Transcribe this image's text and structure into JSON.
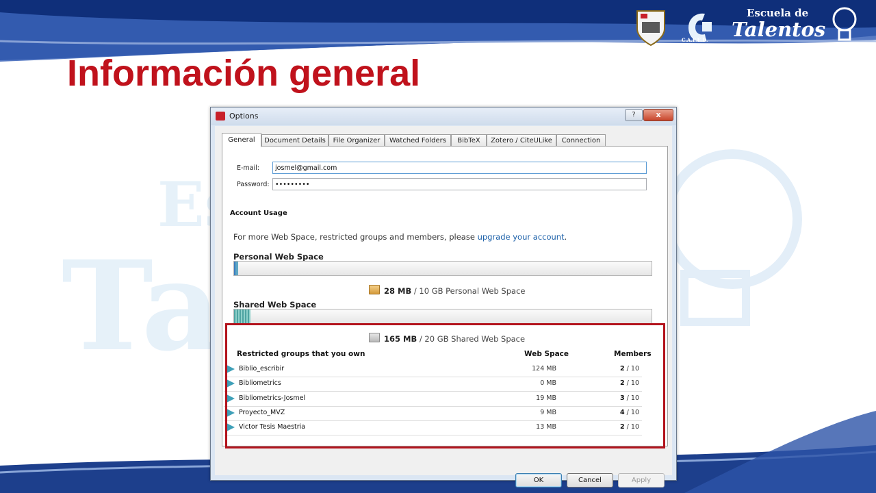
{
  "slide": {
    "title": "Información general",
    "logo_escuela": "Escuela de",
    "logo_talentos": "Talentos",
    "logo_cafed": "C.A.F.E.D."
  },
  "colors": {
    "title_red": "#c0121c",
    "band_blue": "#1d3f8c",
    "highlight_red": "#b3131c",
    "link_blue": "#1a5fa8"
  },
  "dialog": {
    "title": "Options",
    "help_label": "?",
    "close_label": "x",
    "tabs": [
      {
        "label": "General"
      },
      {
        "label": "Document Details"
      },
      {
        "label": "File Organizer"
      },
      {
        "label": "Watched Folders"
      },
      {
        "label": "BibTeX"
      },
      {
        "label": "Zotero / CiteULike"
      },
      {
        "label": "Connection"
      }
    ],
    "email_label": "E-mail:",
    "email_value": "josmel@gmail.com",
    "password_label": "Password:",
    "password_value": "•••••••••",
    "account_usage_title": "Account Usage",
    "info_prefix": "For more Web Space, restricted groups and members, please ",
    "info_link": "upgrade your account",
    "info_suffix": ".",
    "personal": {
      "title": "Personal Web Space",
      "used": "28 MB",
      "rest": " / 10 GB Personal Web Space",
      "fill_fraction": 0.0027
    },
    "shared": {
      "title": "Shared Web Space",
      "used": "165 MB",
      "rest": " / 20 GB Shared Web Space",
      "fill_fraction": 0.008
    },
    "groups_header": {
      "name": "Restricted groups that you own",
      "space": "Web Space",
      "members": "Members"
    },
    "groups": [
      {
        "name": "Biblio_escribir",
        "space": "124 MB",
        "members_count": "2",
        "members_total": " / 10"
      },
      {
        "name": "Bibliometrics",
        "space": "0 MB",
        "members_count": "2",
        "members_total": " / 10"
      },
      {
        "name": "Bibliometrics-Josmel",
        "space": "19 MB",
        "members_count": "3",
        "members_total": " / 10"
      },
      {
        "name": "Proyecto_MVZ",
        "space": "9 MB",
        "members_count": "4",
        "members_total": " / 10"
      },
      {
        "name": "Victor Tesis Maestria",
        "space": "13 MB",
        "members_count": "2",
        "members_total": " / 10"
      }
    ],
    "buttons": {
      "ok": "OK",
      "cancel": "Cancel",
      "apply": "Apply"
    }
  }
}
